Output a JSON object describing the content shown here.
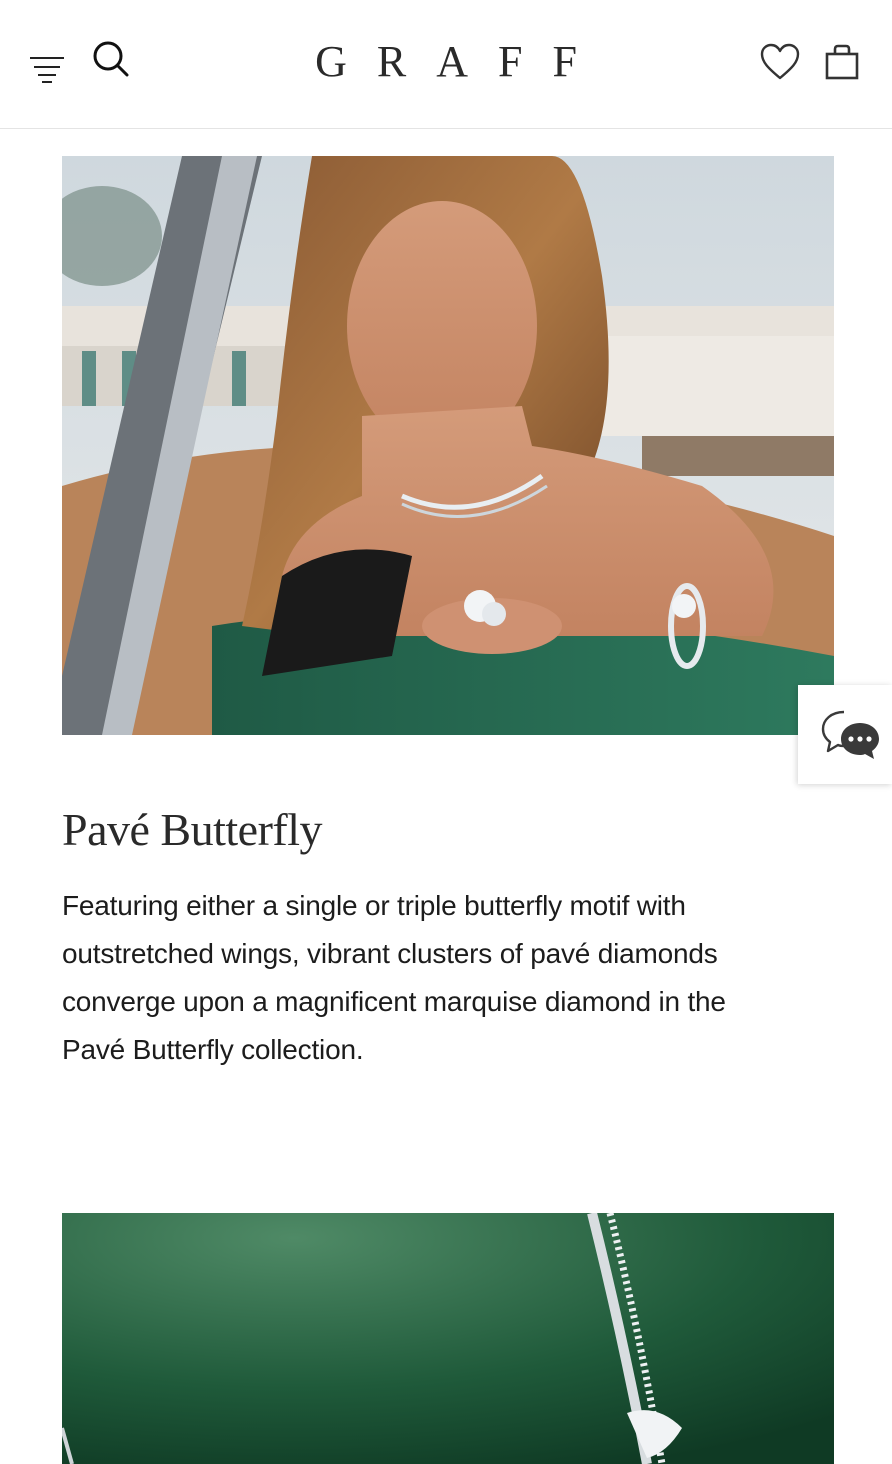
{
  "header": {
    "logo_text": "GRAFF",
    "icons": {
      "menu": "menu-icon",
      "search": "search-icon",
      "wishlist": "heart-icon",
      "bag": "shopping-bag-icon"
    }
  },
  "feature": {
    "title": "Pavé Butterfly",
    "description": "Featuring either a single or triple butterfly motif with outstretched wings, vibrant clusters of pavé diamonds converge upon a magnificent marquise diamond in the Pavé Butterfly collection."
  },
  "chat": {
    "icon": "chat-bubbles-icon"
  },
  "colors": {
    "text": "#1a1a1a",
    "divider": "#e4e4e4",
    "second_image_green": "#1f5a3a"
  }
}
